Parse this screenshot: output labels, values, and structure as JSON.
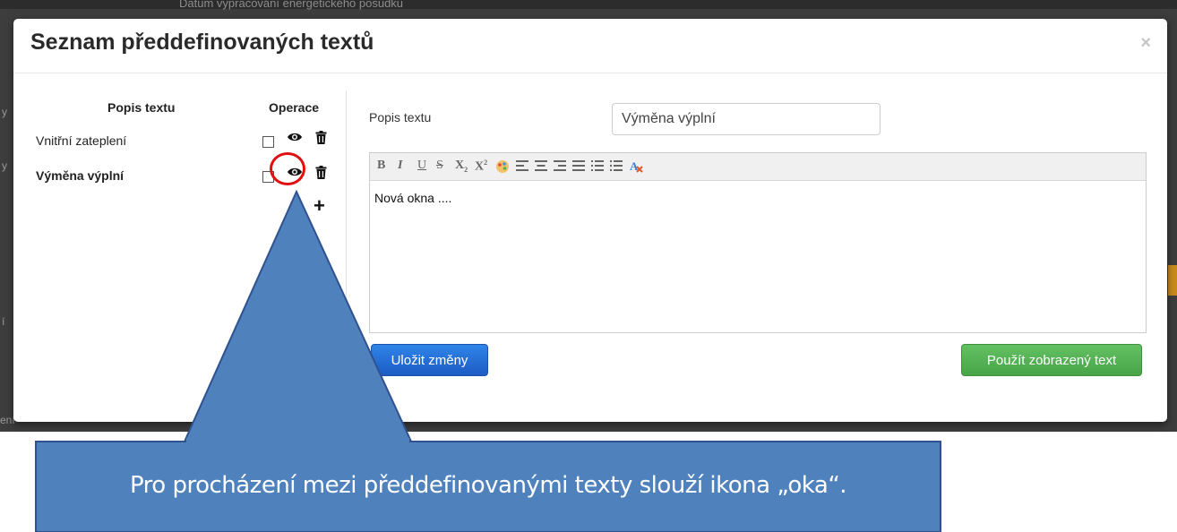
{
  "backdrop": {
    "top_text": "Datum vypracování energetického posudku",
    "side_letters": [
      "y",
      "y",
      "í",
      "ení"
    ]
  },
  "modal": {
    "title": "Seznam předdefinovaných textů",
    "close_symbol": "×"
  },
  "list": {
    "col_description": "Popis textu",
    "col_operations": "Operace",
    "rows": [
      {
        "label": "Vnitřní zateplení",
        "active": false
      },
      {
        "label": "Výměna výplní",
        "active": true
      }
    ],
    "add_symbol": "+"
  },
  "form": {
    "label": "Popis textu",
    "value": "Výměna výplní"
  },
  "editor": {
    "toolbar": [
      "B",
      "I",
      "U",
      "S",
      "x₂",
      "x²",
      "color",
      "align-left",
      "align-center",
      "align-right",
      "justify",
      "ordered-list",
      "unordered-list",
      "remove-format"
    ],
    "content": "Nová okna ...."
  },
  "buttons": {
    "save": "Uložit změny",
    "use": "Použít zobrazený text"
  },
  "callout": {
    "text": "Pro procházení mezi předdefinovanými texty slouží ikona „oka“.",
    "fill": "#4f81bd",
    "stroke": "#2f528f"
  },
  "colors": {
    "highlight_ring": "#e01010",
    "primary": "#1d5cc4",
    "success": "#47a447"
  }
}
